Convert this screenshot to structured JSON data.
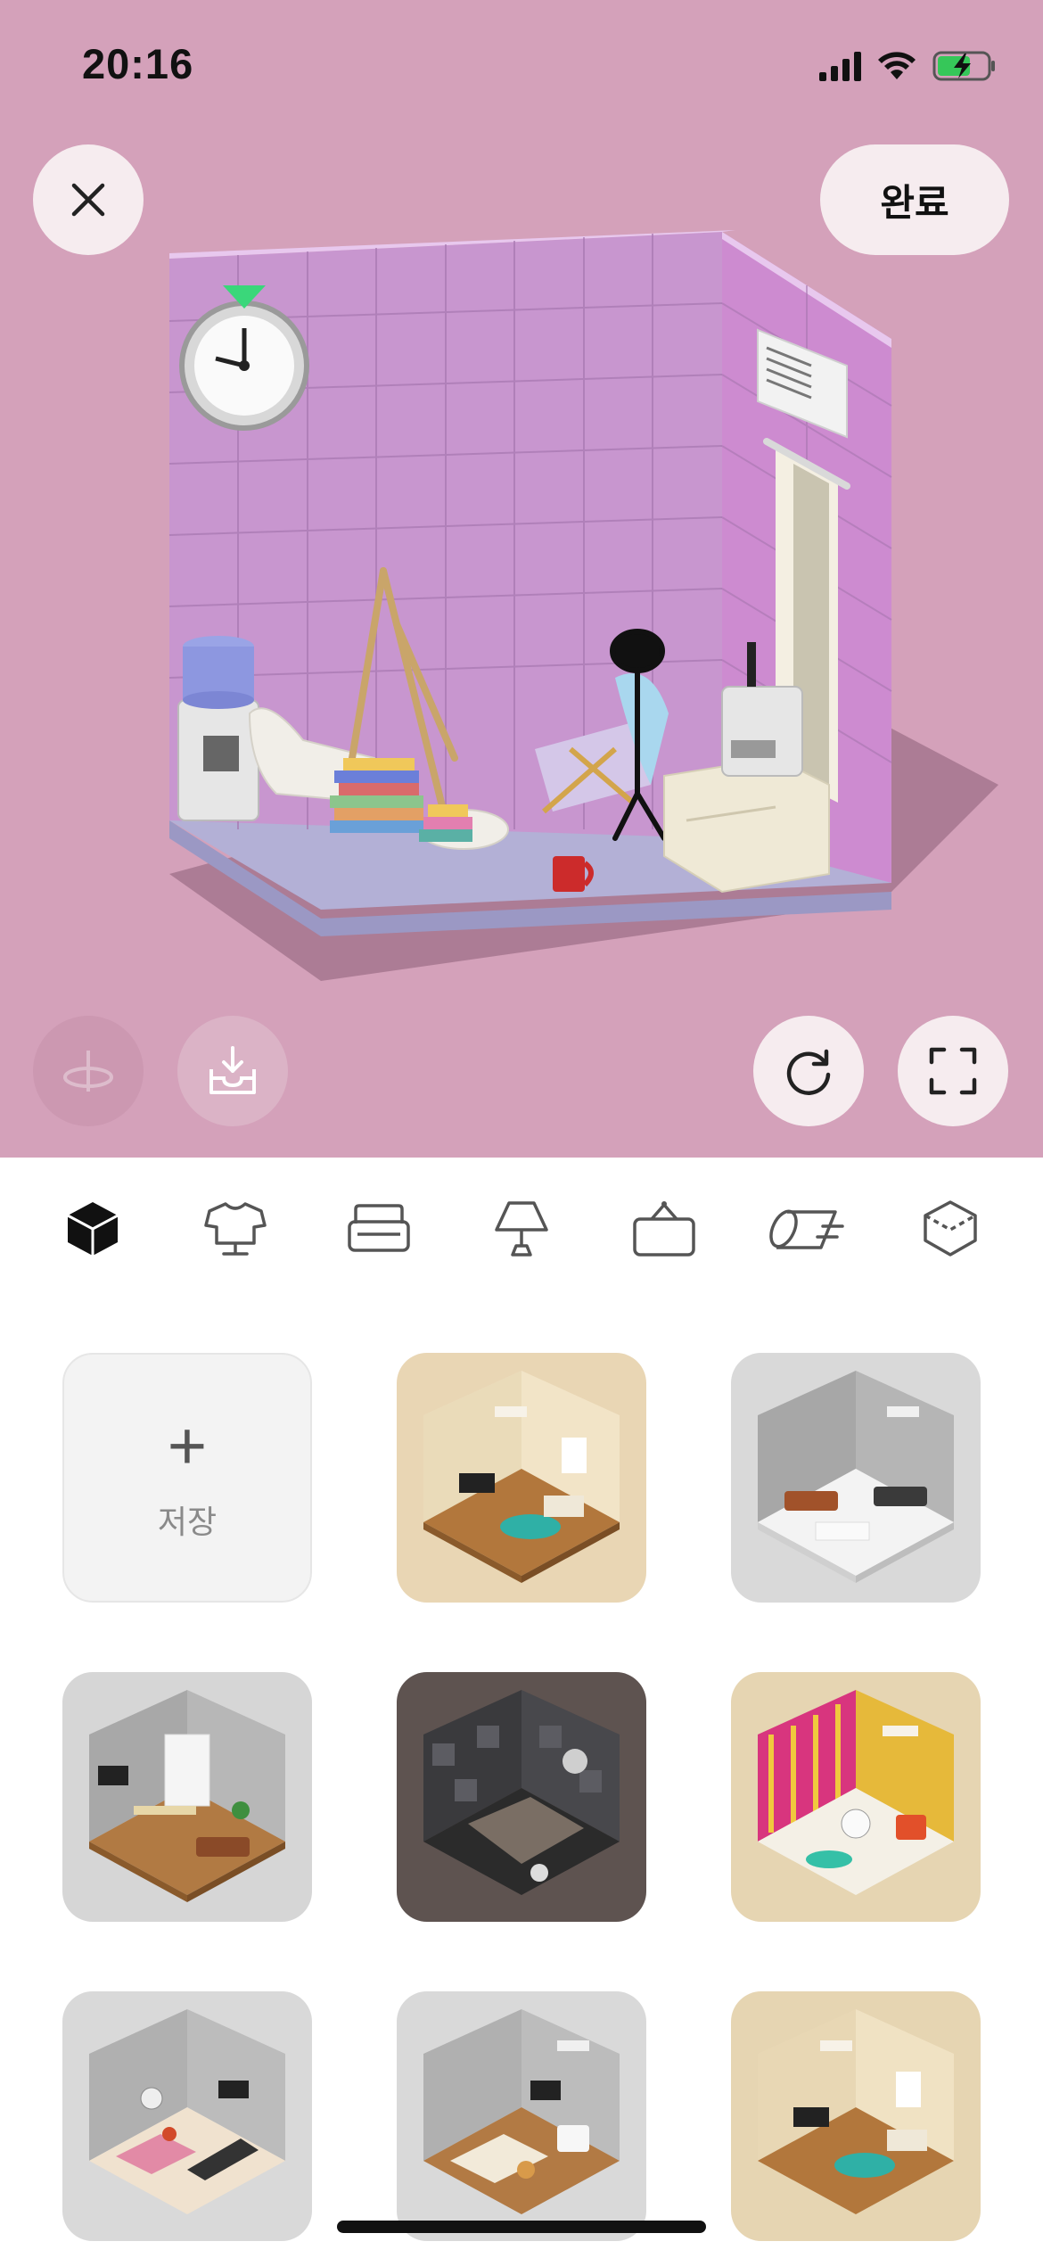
{
  "status_bar": {
    "time": "20:16"
  },
  "header": {
    "done_label": "완료"
  },
  "colors": {
    "editor_background": "#d4a1ba",
    "button_background": "#f6ecef",
    "wall": "#c896cf",
    "floor": "#b3b0d6",
    "active_tab": "#111111",
    "inactive_tab": "#555555"
  },
  "editor_controls": {
    "close_icon": "close-icon",
    "rotate_icon": "rotate-view-icon",
    "save_image_icon": "download-tray-icon",
    "reset_icon": "refresh-icon",
    "fullscreen_icon": "fullscreen-icon"
  },
  "tabs": [
    {
      "icon": "room-cube-icon",
      "active": true
    },
    {
      "icon": "clothing-icon",
      "active": false
    },
    {
      "icon": "sofa-icon",
      "active": false
    },
    {
      "icon": "lamp-icon",
      "active": false
    },
    {
      "icon": "wall-frame-icon",
      "active": false
    },
    {
      "icon": "floor-rug-icon",
      "active": false
    },
    {
      "icon": "wallpaper-icon",
      "active": false
    }
  ],
  "grid": {
    "save_label": "저장",
    "presets": [
      {
        "name": "living-room-beige",
        "background": "#e9d6b4"
      },
      {
        "name": "living-room-gray",
        "background": "#d9d9d9"
      },
      {
        "name": "office-gray",
        "background": "#d6d6d6"
      },
      {
        "name": "bedroom-dark",
        "background": "#5e5350"
      },
      {
        "name": "music-room",
        "background": "#e6d5b2"
      },
      {
        "name": "gym-room",
        "background": "#d9d9d9"
      },
      {
        "name": "bedroom-gray",
        "background": "#d9d9d9"
      },
      {
        "name": "living-room-beige-2",
        "background": "#e6d5b2"
      }
    ]
  }
}
